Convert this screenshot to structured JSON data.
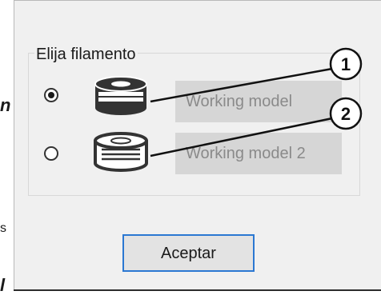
{
  "margin_fragments": {
    "top": "n",
    "middle": "s",
    "bottom": "l"
  },
  "dialog": {
    "group_title": "Elija filamento",
    "options": [
      {
        "label": "Working model",
        "selected": true,
        "spool_icon": "filled-spool-icon"
      },
      {
        "label": "Working model 2",
        "selected": false,
        "spool_icon": "outline-spool-icon"
      }
    ],
    "callouts": [
      "1",
      "2"
    ],
    "accept_label": "Aceptar"
  },
  "colors": {
    "dialog_background": "#f0f0f0",
    "button_border_accent": "#2b78d2",
    "option_label_background": "#d6d6d6",
    "option_label_text": "#8a8a8a"
  }
}
